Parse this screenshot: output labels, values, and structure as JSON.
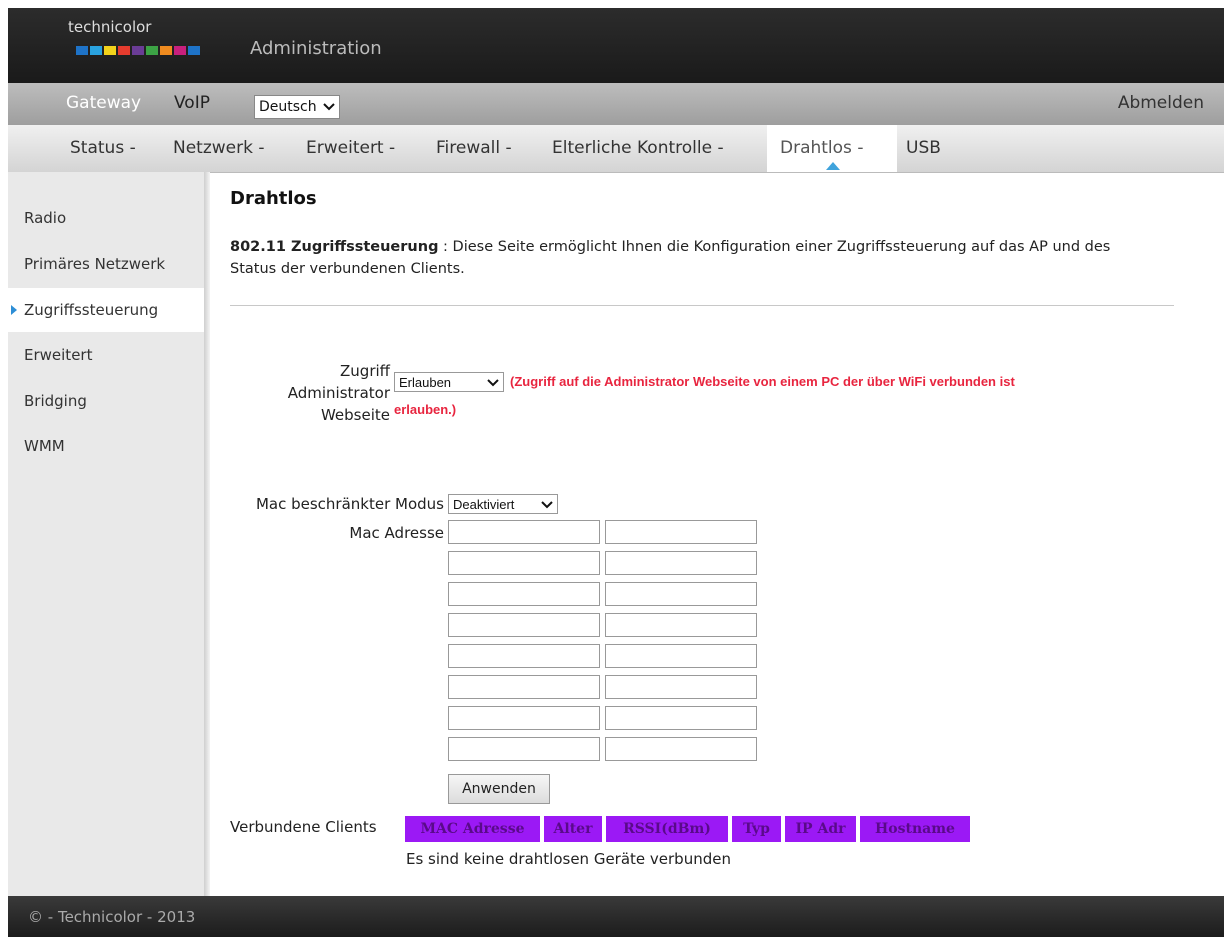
{
  "header": {
    "brand": "technicolor",
    "title": "Administration",
    "logo_colors": [
      "#1e73c8",
      "#2aa3e0",
      "#f2d21b",
      "#e63c2e",
      "#6a3c96",
      "#3ca345",
      "#ef8b1f",
      "#c8207d",
      "#1e73c8"
    ]
  },
  "topbar": {
    "gateway": "Gateway",
    "voip": "VoIP",
    "language": "Deutsch",
    "logout": "Abmelden"
  },
  "nav": {
    "items": [
      "Status -",
      "Netzwerk -",
      "Erweitert -",
      "Firewall -",
      "Elterliche Kontrolle -",
      "Drahtlos -",
      "USB"
    ],
    "active": "Drahtlos -"
  },
  "sidebar": {
    "items": [
      "Radio",
      "Primäres Netzwerk",
      "Zugriffssteuerung",
      "Erweitert",
      "Bridging",
      "WMM"
    ],
    "active": "Zugriffssteuerung"
  },
  "page": {
    "title": "Drahtlos",
    "desc_bold": "802.11 Zugriffssteuerung",
    "desc_text": " :  Diese Seite ermöglicht Ihnen die Konfiguration einer Zugriffssteuerung auf das AP und des Status der verbundenen Clients.",
    "admin_label_1": "Zugriff",
    "admin_label_2": "Administrator",
    "admin_label_3": "Webseite",
    "admin_select": "Erlauben",
    "admin_note_1": "(Zugriff auf die Administrator Webseite von einem PC der über WiFi verbunden ist",
    "admin_note_2": "erlauben.)",
    "mac_mode_label": "Mac beschränkter Modus",
    "mac_mode_select": "Deaktiviert",
    "mac_address_label": "Mac Adresse",
    "apply_button": "Anwenden",
    "clients_label": "Verbundene Clients",
    "clients_headers": [
      "MAC Adresse",
      "Alter",
      "RSSI(dBm)",
      "Typ",
      "IP Adr",
      "Hostname"
    ],
    "no_clients": "Es sind keine drahtlosen Geräte verbunden"
  },
  "footer": {
    "text": "© - Technicolor - 2013"
  }
}
